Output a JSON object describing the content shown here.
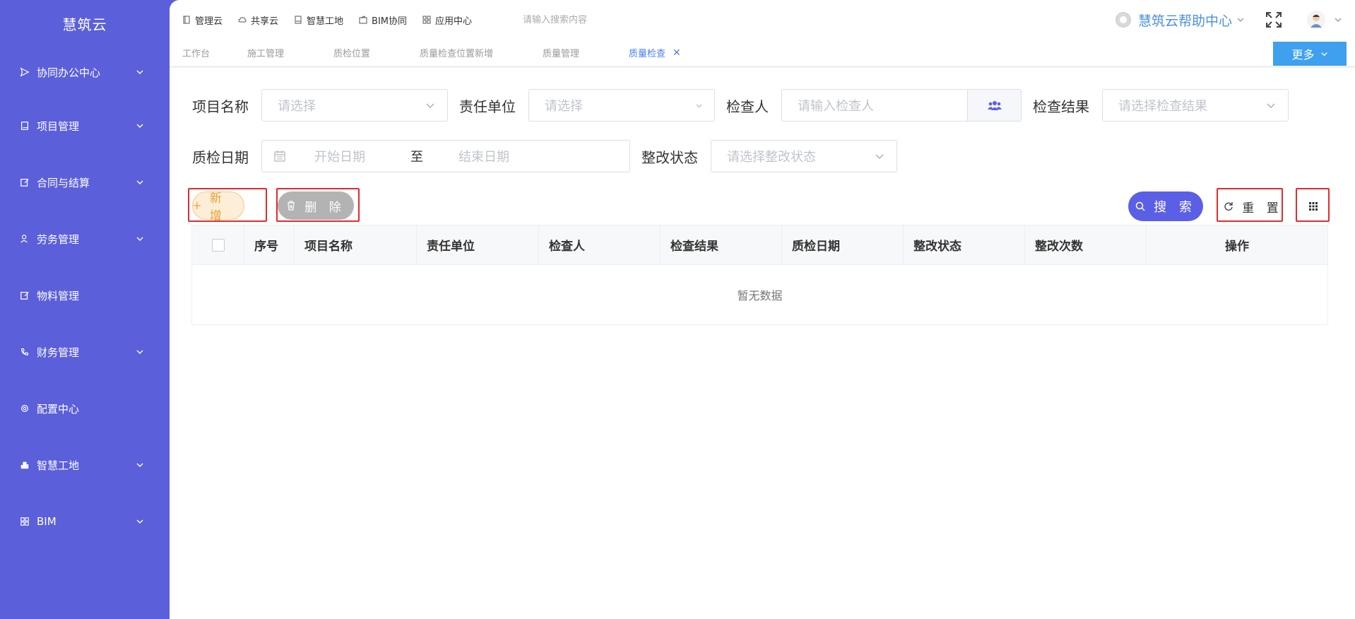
{
  "app": {
    "title": "慧筑云"
  },
  "sidebar": {
    "items": [
      {
        "label": "协同办公中心",
        "icon": "send-icon",
        "has_children": true
      },
      {
        "label": "项目管理",
        "icon": "book-icon",
        "has_children": true
      },
      {
        "label": "合同与结算",
        "icon": "edit-icon",
        "has_children": true
      },
      {
        "label": "劳务管理",
        "icon": "user-icon",
        "has_children": true
      },
      {
        "label": "物料管理",
        "icon": "edit-icon",
        "has_children": false
      },
      {
        "label": "财务管理",
        "icon": "phone-icon",
        "has_children": true
      },
      {
        "label": "配置中心",
        "icon": "gear-icon",
        "has_children": false
      },
      {
        "label": "智慧工地",
        "icon": "building-icon",
        "has_children": true
      },
      {
        "label": "BIM",
        "icon": "grid-icon",
        "has_children": true
      }
    ]
  },
  "topnav": {
    "items": [
      {
        "label": "管理云",
        "icon": "doc-icon"
      },
      {
        "label": "共享云",
        "icon": "cloud-icon"
      },
      {
        "label": "智慧工地",
        "icon": "book-icon"
      },
      {
        "label": "BIM协同",
        "icon": "wallet-icon"
      },
      {
        "label": "应用中心",
        "icon": "apps-icon"
      }
    ],
    "search_placeholder": "请输入搜索内容",
    "help_label": "慧筑云帮助中心"
  },
  "tabs": {
    "items": [
      {
        "label": "工作台"
      },
      {
        "label": "施工管理"
      },
      {
        "label": "质检位置"
      },
      {
        "label": "质量检查位置新增"
      },
      {
        "label": "质量管理"
      },
      {
        "label": "质量检查",
        "active": true
      }
    ],
    "close_symbol": "✕",
    "more_label": "更多"
  },
  "filters": {
    "project_name": {
      "label": "项目名称",
      "placeholder": "请选择"
    },
    "responsible_unit": {
      "label": "责任单位",
      "placeholder": "请选择"
    },
    "inspector": {
      "label": "检查人",
      "placeholder": "请输入检查人"
    },
    "inspection_result": {
      "label": "检查结果",
      "placeholder": "请选择检查结果"
    },
    "inspection_date": {
      "label": "质检日期",
      "start_placeholder": "开始日期",
      "separator": "至",
      "end_placeholder": "结束日期"
    },
    "rectify_status": {
      "label": "整改状态",
      "placeholder": "请选择整改状态"
    }
  },
  "actions": {
    "add_label": "新 增",
    "delete_label": "删 除",
    "search_label": "搜 索",
    "reset_label": "重 置"
  },
  "table": {
    "columns": [
      "序号",
      "项目名称",
      "责任单位",
      "检查人",
      "检查结果",
      "质检日期",
      "整改状态",
      "整改次数",
      "操作"
    ],
    "empty_text": "暂无数据"
  },
  "colors": {
    "sidebar_bg": "#5b5fd9",
    "primary": "#5b5fe6",
    "link": "#4a7df0",
    "more_btn": "#3fa0ef",
    "add_btn_bg": "#fdeed7",
    "add_btn_text": "#e8a23e",
    "delete_btn_bg": "#b3b3b3",
    "highlight_box": "#e52a2a"
  }
}
